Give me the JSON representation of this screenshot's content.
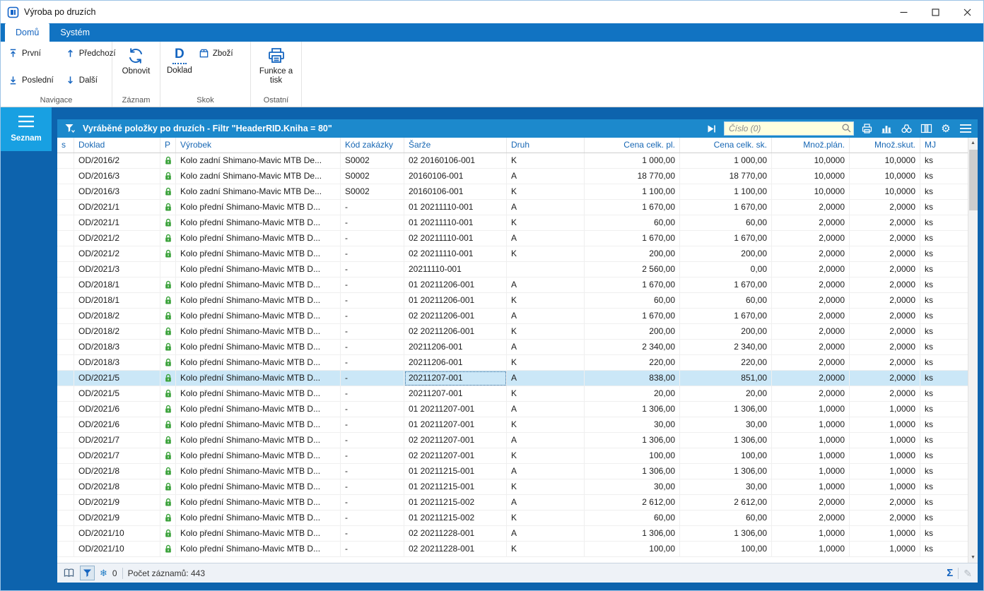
{
  "window": {
    "title": "Výroba po druzích"
  },
  "ribbon": {
    "tabs": [
      {
        "label": "Domů"
      },
      {
        "label": "Systém"
      }
    ],
    "buttons": {
      "first": "První",
      "last": "Poslední",
      "prev": "Předchozí",
      "next": "Další",
      "refresh": "Obnovit",
      "doklad": "Doklad",
      "zbozi": "Zboží",
      "funkce": "Funkce a tisk"
    },
    "groups": {
      "navigace": "Navigace",
      "zaznam": "Záznam",
      "skok": "Skok",
      "ostatni": "Ostatní"
    }
  },
  "icons": {
    "doklad_letter": "D",
    "gear": "⚙",
    "sum": "Σ",
    "pencil": "✎",
    "snowflake": "❄",
    "scroll_up": "▲",
    "scroll_down": "▼"
  },
  "sidebar": {
    "seznam": "Seznam"
  },
  "toolbar": {
    "caption": "Vyráběné položky po druzích - Filtr \"HeaderRID.Kniha = 80\"",
    "search_placeholder": "Číslo (0)"
  },
  "table": {
    "columns": [
      {
        "key": "s",
        "label": "s",
        "align": "left"
      },
      {
        "key": "doklad",
        "label": "Doklad",
        "align": "left"
      },
      {
        "key": "p",
        "label": "P",
        "align": "left"
      },
      {
        "key": "vyrobek",
        "label": "Výrobek",
        "align": "left"
      },
      {
        "key": "kod",
        "label": "Kód zakázky",
        "align": "left"
      },
      {
        "key": "sarze",
        "label": "Šarže",
        "align": "left"
      },
      {
        "key": "druh",
        "label": "Druh",
        "align": "left"
      },
      {
        "key": "cena_pl",
        "label": "Cena celk. pl.",
        "align": "right"
      },
      {
        "key": "cena_sk",
        "label": "Cena celk. sk.",
        "align": "right"
      },
      {
        "key": "mnoz_plan",
        "label": "Množ.plán.",
        "align": "right"
      },
      {
        "key": "mnoz_skut",
        "label": "Množ.skut.",
        "align": "right"
      },
      {
        "key": "mj",
        "label": "MJ",
        "align": "left"
      }
    ],
    "selected_row": 14,
    "focused_col": "sarze",
    "rows": [
      {
        "doklad": "OD/2016/2",
        "locked": true,
        "vyrobek": "Kolo zadní Shimano-Mavic MTB De...",
        "kod": "S0002",
        "sarze": "02 20160106-001",
        "druh": "K",
        "cena_pl": "1 000,00",
        "cena_sk": "1 000,00",
        "mnoz_plan": "10,0000",
        "mnoz_skut": "10,0000",
        "mj": "ks"
      },
      {
        "doklad": "OD/2016/3",
        "locked": true,
        "vyrobek": "Kolo zadní Shimano-Mavic MTB De...",
        "kod": "S0002",
        "sarze": "20160106-001",
        "druh": "A",
        "cena_pl": "18 770,00",
        "cena_sk": "18 770,00",
        "mnoz_plan": "10,0000",
        "mnoz_skut": "10,0000",
        "mj": "ks"
      },
      {
        "doklad": "OD/2016/3",
        "locked": true,
        "vyrobek": "Kolo zadní Shimano-Mavic MTB De...",
        "kod": "S0002",
        "sarze": "20160106-001",
        "druh": "K",
        "cena_pl": "1 100,00",
        "cena_sk": "1 100,00",
        "mnoz_plan": "10,0000",
        "mnoz_skut": "10,0000",
        "mj": "ks"
      },
      {
        "doklad": "OD/2021/1",
        "locked": true,
        "vyrobek": "Kolo přední Shimano-Mavic MTB D...",
        "kod": "-",
        "sarze": "01 20211110-001",
        "druh": "A",
        "cena_pl": "1 670,00",
        "cena_sk": "1 670,00",
        "mnoz_plan": "2,0000",
        "mnoz_skut": "2,0000",
        "mj": "ks"
      },
      {
        "doklad": "OD/2021/1",
        "locked": true,
        "vyrobek": "Kolo přední Shimano-Mavic MTB D...",
        "kod": "-",
        "sarze": "01 20211110-001",
        "druh": "K",
        "cena_pl": "60,00",
        "cena_sk": "60,00",
        "mnoz_plan": "2,0000",
        "mnoz_skut": "2,0000",
        "mj": "ks"
      },
      {
        "doklad": "OD/2021/2",
        "locked": true,
        "vyrobek": "Kolo přední Shimano-Mavic MTB D...",
        "kod": "-",
        "sarze": "02 20211110-001",
        "druh": "A",
        "cena_pl": "1 670,00",
        "cena_sk": "1 670,00",
        "mnoz_plan": "2,0000",
        "mnoz_skut": "2,0000",
        "mj": "ks"
      },
      {
        "doklad": "OD/2021/2",
        "locked": true,
        "vyrobek": "Kolo přední Shimano-Mavic MTB D...",
        "kod": "-",
        "sarze": "02 20211110-001",
        "druh": "K",
        "cena_pl": "200,00",
        "cena_sk": "200,00",
        "mnoz_plan": "2,0000",
        "mnoz_skut": "2,0000",
        "mj": "ks"
      },
      {
        "doklad": "OD/2021/3",
        "locked": false,
        "vyrobek": "Kolo přední Shimano-Mavic MTB D...",
        "kod": "-",
        "sarze": "20211110-001",
        "druh": "",
        "cena_pl": "2 560,00",
        "cena_sk": "0,00",
        "mnoz_plan": "2,0000",
        "mnoz_skut": "2,0000",
        "mj": "ks"
      },
      {
        "doklad": "OD/2018/1",
        "locked": true,
        "vyrobek": "Kolo přední Shimano-Mavic MTB D...",
        "kod": "-",
        "sarze": "01 20211206-001",
        "druh": "A",
        "cena_pl": "1 670,00",
        "cena_sk": "1 670,00",
        "mnoz_plan": "2,0000",
        "mnoz_skut": "2,0000",
        "mj": "ks"
      },
      {
        "doklad": "OD/2018/1",
        "locked": true,
        "vyrobek": "Kolo přední Shimano-Mavic MTB D...",
        "kod": "-",
        "sarze": "01 20211206-001",
        "druh": "K",
        "cena_pl": "60,00",
        "cena_sk": "60,00",
        "mnoz_plan": "2,0000",
        "mnoz_skut": "2,0000",
        "mj": "ks"
      },
      {
        "doklad": "OD/2018/2",
        "locked": true,
        "vyrobek": "Kolo přední Shimano-Mavic MTB D...",
        "kod": "-",
        "sarze": "02 20211206-001",
        "druh": "A",
        "cena_pl": "1 670,00",
        "cena_sk": "1 670,00",
        "mnoz_plan": "2,0000",
        "mnoz_skut": "2,0000",
        "mj": "ks"
      },
      {
        "doklad": "OD/2018/2",
        "locked": true,
        "vyrobek": "Kolo přední Shimano-Mavic MTB D...",
        "kod": "-",
        "sarze": "02 20211206-001",
        "druh": "K",
        "cena_pl": "200,00",
        "cena_sk": "200,00",
        "mnoz_plan": "2,0000",
        "mnoz_skut": "2,0000",
        "mj": "ks"
      },
      {
        "doklad": "OD/2018/3",
        "locked": true,
        "vyrobek": "Kolo přední Shimano-Mavic MTB D...",
        "kod": "-",
        "sarze": "20211206-001",
        "druh": "A",
        "cena_pl": "2 340,00",
        "cena_sk": "2 340,00",
        "mnoz_plan": "2,0000",
        "mnoz_skut": "2,0000",
        "mj": "ks"
      },
      {
        "doklad": "OD/2018/3",
        "locked": true,
        "vyrobek": "Kolo přední Shimano-Mavic MTB D...",
        "kod": "-",
        "sarze": "20211206-001",
        "druh": "K",
        "cena_pl": "220,00",
        "cena_sk": "220,00",
        "mnoz_plan": "2,0000",
        "mnoz_skut": "2,0000",
        "mj": "ks"
      },
      {
        "doklad": "OD/2021/5",
        "locked": true,
        "vyrobek": "Kolo přední Shimano-Mavic MTB D...",
        "kod": "-",
        "sarze": "20211207-001",
        "druh": "A",
        "cena_pl": "838,00",
        "cena_sk": "851,00",
        "mnoz_plan": "2,0000",
        "mnoz_skut": "2,0000",
        "mj": "ks"
      },
      {
        "doklad": "OD/2021/5",
        "locked": true,
        "vyrobek": "Kolo přední Shimano-Mavic MTB D...",
        "kod": "-",
        "sarze": "20211207-001",
        "druh": "K",
        "cena_pl": "20,00",
        "cena_sk": "20,00",
        "mnoz_plan": "2,0000",
        "mnoz_skut": "2,0000",
        "mj": "ks"
      },
      {
        "doklad": "OD/2021/6",
        "locked": true,
        "vyrobek": "Kolo přední Shimano-Mavic MTB D...",
        "kod": "-",
        "sarze": "01 20211207-001",
        "druh": "A",
        "cena_pl": "1 306,00",
        "cena_sk": "1 306,00",
        "mnoz_plan": "1,0000",
        "mnoz_skut": "1,0000",
        "mj": "ks"
      },
      {
        "doklad": "OD/2021/6",
        "locked": true,
        "vyrobek": "Kolo přední Shimano-Mavic MTB D...",
        "kod": "-",
        "sarze": "01 20211207-001",
        "druh": "K",
        "cena_pl": "30,00",
        "cena_sk": "30,00",
        "mnoz_plan": "1,0000",
        "mnoz_skut": "1,0000",
        "mj": "ks"
      },
      {
        "doklad": "OD/2021/7",
        "locked": true,
        "vyrobek": "Kolo přední Shimano-Mavic MTB D...",
        "kod": "-",
        "sarze": "02 20211207-001",
        "druh": "A",
        "cena_pl": "1 306,00",
        "cena_sk": "1 306,00",
        "mnoz_plan": "1,0000",
        "mnoz_skut": "1,0000",
        "mj": "ks"
      },
      {
        "doklad": "OD/2021/7",
        "locked": true,
        "vyrobek": "Kolo přední Shimano-Mavic MTB D...",
        "kod": "-",
        "sarze": "02 20211207-001",
        "druh": "K",
        "cena_pl": "100,00",
        "cena_sk": "100,00",
        "mnoz_plan": "1,0000",
        "mnoz_skut": "1,0000",
        "mj": "ks"
      },
      {
        "doklad": "OD/2021/8",
        "locked": true,
        "vyrobek": "Kolo přední Shimano-Mavic MTB D...",
        "kod": "-",
        "sarze": "01 20211215-001",
        "druh": "A",
        "cena_pl": "1 306,00",
        "cena_sk": "1 306,00",
        "mnoz_plan": "1,0000",
        "mnoz_skut": "1,0000",
        "mj": "ks"
      },
      {
        "doklad": "OD/2021/8",
        "locked": true,
        "vyrobek": "Kolo přední Shimano-Mavic MTB D...",
        "kod": "-",
        "sarze": "01 20211215-001",
        "druh": "K",
        "cena_pl": "30,00",
        "cena_sk": "30,00",
        "mnoz_plan": "1,0000",
        "mnoz_skut": "1,0000",
        "mj": "ks"
      },
      {
        "doklad": "OD/2021/9",
        "locked": true,
        "vyrobek": "Kolo přední Shimano-Mavic MTB D...",
        "kod": "-",
        "sarze": "01 20211215-002",
        "druh": "A",
        "cena_pl": "2 612,00",
        "cena_sk": "2 612,00",
        "mnoz_plan": "2,0000",
        "mnoz_skut": "2,0000",
        "mj": "ks"
      },
      {
        "doklad": "OD/2021/9",
        "locked": true,
        "vyrobek": "Kolo přední Shimano-Mavic MTB D...",
        "kod": "-",
        "sarze": "01 20211215-002",
        "druh": "K",
        "cena_pl": "60,00",
        "cena_sk": "60,00",
        "mnoz_plan": "2,0000",
        "mnoz_skut": "2,0000",
        "mj": "ks"
      },
      {
        "doklad": "OD/2021/10",
        "locked": true,
        "vyrobek": "Kolo přední Shimano-Mavic MTB D...",
        "kod": "-",
        "sarze": "02 20211228-001",
        "druh": "A",
        "cena_pl": "1 306,00",
        "cena_sk": "1 306,00",
        "mnoz_plan": "1,0000",
        "mnoz_skut": "1,0000",
        "mj": "ks"
      },
      {
        "doklad": "OD/2021/10",
        "locked": true,
        "vyrobek": "Kolo přední Shimano-Mavic MTB D...",
        "kod": "-",
        "sarze": "02 20211228-001",
        "druh": "K",
        "cena_pl": "100,00",
        "cena_sk": "100,00",
        "mnoz_plan": "1,0000",
        "mnoz_skut": "1,0000",
        "mj": "ks"
      }
    ]
  },
  "statusbar": {
    "freeze_count": "0",
    "count_label": "Počet záznamů: 443"
  }
}
